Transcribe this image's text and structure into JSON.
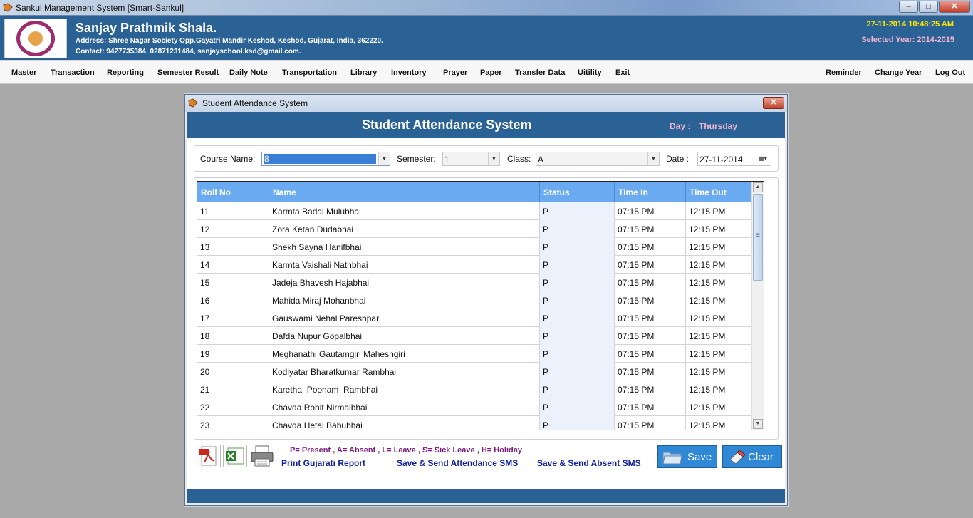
{
  "window": {
    "title": "Sankul Management System [Smart-Sankul]",
    "minimize": "–",
    "maximize": "□",
    "close": "✕"
  },
  "header": {
    "school_name": "Sanjay Prathmik Shala.",
    "address": "Address: Shree Nagar Society  Opp.Gayatri Mandir Keshod, Keshod, Gujarat, India, 362220.",
    "contact": "Contact: 9427735384, 02871231484, sanjayschool.ksd@gmail.com.",
    "datetime": "27-11-2014 10:48:25 AM",
    "selected_year": "Selected Year: 2014-2015"
  },
  "menu": {
    "left": [
      "Master",
      "Transaction",
      "Reporting",
      "Semester Result",
      "Daily Note",
      "Transportation",
      "Library",
      "Inventory",
      "Prayer",
      "Paper",
      "Transfer Data",
      "Uitility",
      "Exit"
    ],
    "right": [
      "Reminder",
      "Change Year",
      "Log Out"
    ]
  },
  "dialog": {
    "title": "Student Attendance System",
    "heading": "Student Attendance System",
    "day_label": "Day :",
    "day_value": "Thursday",
    "close": "✕"
  },
  "filters": {
    "course_label": "Course Name:",
    "course_value": "8",
    "semester_label": "Semester:",
    "semester_value": "1",
    "class_label": "Class:",
    "class_value": "A",
    "date_label": "Date :",
    "date_value": "27-11-2014"
  },
  "grid": {
    "columns": [
      "Roll No",
      "Name",
      "Status",
      "Time In",
      "Time Out"
    ],
    "rows": [
      [
        "11",
        "Karmta Badal Mulubhai",
        "P",
        "07:15 PM",
        "12:15 PM"
      ],
      [
        "12",
        "Zora Ketan Dudabhai",
        "P",
        "07:15 PM",
        "12:15 PM"
      ],
      [
        "13",
        "Shekh Sayna Hanifbhai",
        "P",
        "07:15 PM",
        "12:15 PM"
      ],
      [
        "14",
        "Karmta Vaishali Nathbhai",
        "P",
        "07:15 PM",
        "12:15 PM"
      ],
      [
        "15",
        "Jadeja Bhavesh Hajabhai",
        "P",
        "07:15 PM",
        "12:15 PM"
      ],
      [
        "16",
        "Mahida Miraj Mohanbhai",
        "P",
        "07:15 PM",
        "12:15 PM"
      ],
      [
        "17",
        "Gauswami Nehal Pareshpari",
        "P",
        "07:15 PM",
        "12:15 PM"
      ],
      [
        "18",
        "Dafda Nupur Gopalbhai",
        "P",
        "07:15 PM",
        "12:15 PM"
      ],
      [
        "19",
        "Meghanathi Gautamgiri Maheshgiri",
        "P",
        "07:15 PM",
        "12:15 PM"
      ],
      [
        "20",
        "Kodiyatar Bharatkumar Rambhai",
        "P",
        "07:15 PM",
        "12:15 PM"
      ],
      [
        "21",
        "Karetha  Poonam  Rambhai",
        "P",
        "07:15 PM",
        "12:15 PM"
      ],
      [
        "22",
        "Chavda Rohit Nirmalbhai",
        "P",
        "07:15 PM",
        "12:15 PM"
      ],
      [
        "23",
        "Chavda Hetal Babubhai",
        "P",
        "07:15 PM",
        "12:15 PM"
      ]
    ]
  },
  "footer": {
    "legend": "P= Present , A= Absent , L= Leave , S= Sick Leave , H= Holiday",
    "print_gujarati": "Print Gujarati Report",
    "save_send_attendance": "Save & Send Attendance SMS",
    "save_send_absent": "Save & Send Absent SMS",
    "save": "Save",
    "clear": "Clear"
  },
  "icons": [
    "pdf-icon",
    "excel-icon",
    "printer-icon",
    "folder-icon",
    "eraser-icon",
    "calendar-icon"
  ],
  "colors": {
    "header_blue": "#2b6295",
    "grid_header": "#6aaaf0",
    "legend": "#7a1a7a",
    "link": "#0d1f9c",
    "date_yellow": "#ffe600",
    "year_pink": "#f4b6d0"
  }
}
